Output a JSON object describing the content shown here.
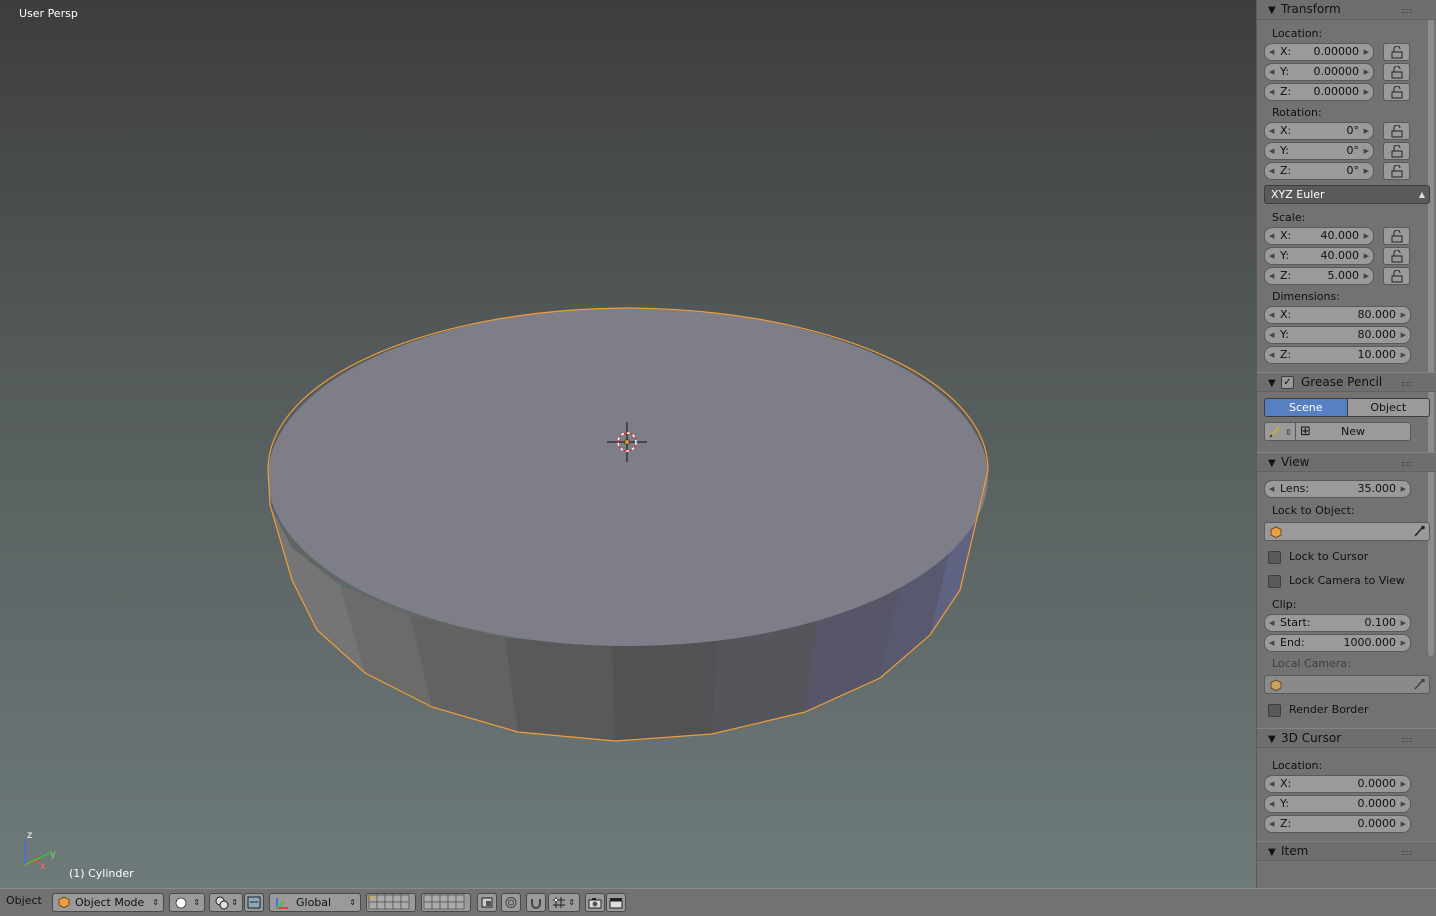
{
  "viewport": {
    "view_label": "User Persp",
    "object_label": "(1) Cylinder"
  },
  "colors": {
    "selection_outline": "#ffa336",
    "active_tab": "#5680c2",
    "panel_bg": "#727272"
  },
  "transform": {
    "title": "Transform",
    "location_label": "Location:",
    "location": [
      {
        "axis": "X:",
        "value": "0.00000"
      },
      {
        "axis": "Y:",
        "value": "0.00000"
      },
      {
        "axis": "Z:",
        "value": "0.00000"
      }
    ],
    "rotation_label": "Rotation:",
    "rotation": [
      {
        "axis": "X:",
        "value": "0°"
      },
      {
        "axis": "Y:",
        "value": "0°"
      },
      {
        "axis": "Z:",
        "value": "0°"
      }
    ],
    "rotation_mode": "XYZ Euler",
    "scale_label": "Scale:",
    "scale": [
      {
        "axis": "X:",
        "value": "40.000"
      },
      {
        "axis": "Y:",
        "value": "40.000"
      },
      {
        "axis": "Z:",
        "value": "5.000"
      }
    ],
    "dimensions_label": "Dimensions:",
    "dimensions": [
      {
        "axis": "X:",
        "value": "80.000"
      },
      {
        "axis": "Y:",
        "value": "80.000"
      },
      {
        "axis": "Z:",
        "value": "10.000"
      }
    ]
  },
  "grease_pencil": {
    "title": "Grease Pencil",
    "tab_scene": "Scene",
    "tab_object": "Object",
    "new_label": "New"
  },
  "view": {
    "title": "View",
    "lens_label": "Lens:",
    "lens_value": "35.000",
    "lock_object_label": "Lock to Object:",
    "lock_cursor_label": "Lock to Cursor",
    "lock_camera_label": "Lock Camera to View",
    "clip_label": "Clip:",
    "clip_start_label": "Start:",
    "clip_start_value": "0.100",
    "clip_end_label": "End:",
    "clip_end_value": "1000.000",
    "local_camera_label": "Local Camera:",
    "render_border_label": "Render Border"
  },
  "cursor3d": {
    "title": "3D Cursor",
    "location_label": "Location:",
    "location": [
      {
        "axis": "X:",
        "value": "0.0000"
      },
      {
        "axis": "Y:",
        "value": "0.0000"
      },
      {
        "axis": "Z:",
        "value": "0.0000"
      }
    ]
  },
  "item": {
    "title": "Item"
  },
  "header": {
    "menu_label": "Object",
    "mode_label": "Object Mode",
    "orientation_label": "Global"
  },
  "axes": {
    "x": "x",
    "y": "y",
    "z": "z"
  }
}
